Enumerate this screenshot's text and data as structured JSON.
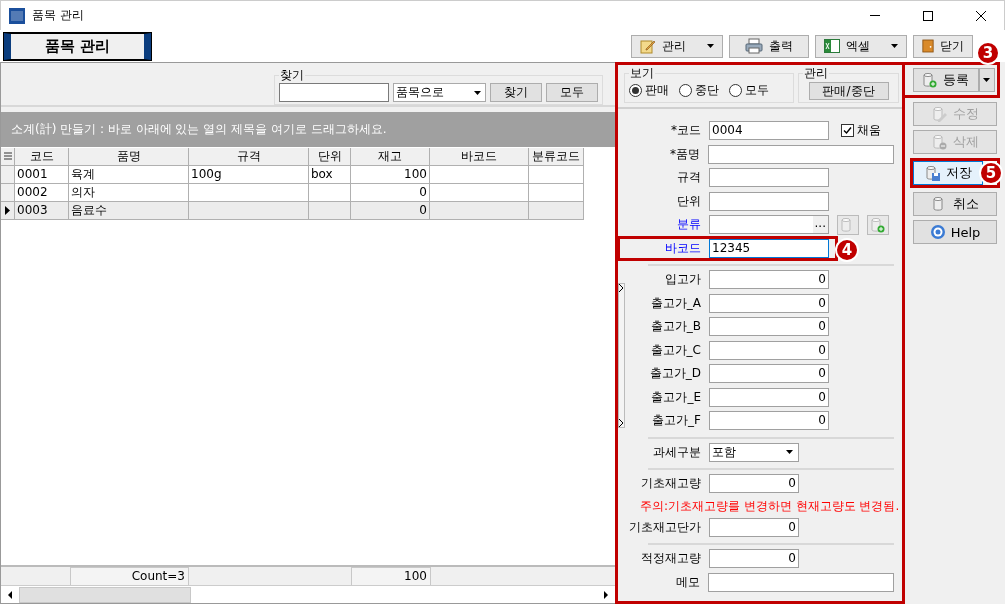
{
  "window": {
    "title": "품목 관리"
  },
  "header": {
    "title": "품목 관리"
  },
  "toolbar": [
    {
      "label": "관리",
      "kind": "menu"
    },
    {
      "label": "출력",
      "kind": "print"
    },
    {
      "label": "엑셀",
      "kind": "excel"
    },
    {
      "label": "닫기",
      "kind": "close"
    }
  ],
  "search": {
    "legend": "찾기",
    "mode": "품목으로",
    "buttons": [
      "찾기",
      "모두"
    ]
  },
  "group_hint": "소계(計) 만들기 : 바로 아래에 있는 열의 제목을 여기로 드래그하세요.",
  "table": {
    "columns": [
      "코드",
      "품명",
      "규격",
      "단위",
      "재고",
      "바코드",
      "분류코드"
    ],
    "rows": [
      {
        "cells": [
          "0001",
          "육계",
          "100g",
          "box",
          "100",
          "",
          ""
        ],
        "selected": false
      },
      {
        "cells": [
          "0002",
          "의자",
          "",
          "",
          "0",
          "",
          ""
        ],
        "selected": false
      },
      {
        "cells": [
          "0003",
          "음료수",
          "",
          "",
          "0",
          "",
          ""
        ],
        "selected": true
      }
    ]
  },
  "footer": {
    "count": "Count=3",
    "total": "100"
  },
  "view": {
    "legend": "보기",
    "options": [
      {
        "label": "판매",
        "selected": true
      },
      {
        "label": "중단",
        "selected": false
      },
      {
        "label": "모두",
        "selected": false
      }
    ]
  },
  "manage": {
    "legend": "관리",
    "button": "판매/중단"
  },
  "sections": [
    [
      {
        "kind": "text",
        "label": "*코드",
        "value": "0004",
        "checkbox": {
          "label": "채움",
          "checked": true
        }
      },
      {
        "kind": "wide",
        "label": "*품명"
      },
      {
        "kind": "text",
        "label": "규격"
      },
      {
        "kind": "text",
        "label": "단위"
      },
      {
        "kind": "lookup",
        "label": "분류",
        "link": true,
        "ellipsis": "..."
      },
      {
        "kind": "text",
        "label": "바코드",
        "value": "12345",
        "link": true,
        "focused": true,
        "callout": "4"
      }
    ],
    [
      {
        "kind": "number",
        "label": "입고가",
        "value": "0"
      },
      {
        "kind": "number",
        "label": "출고가_A",
        "value": "0"
      },
      {
        "kind": "number",
        "label": "출고가_B",
        "value": "0"
      },
      {
        "kind": "number",
        "label": "출고가_C",
        "value": "0"
      },
      {
        "kind": "number",
        "label": "출고가_D",
        "value": "0"
      },
      {
        "kind": "number",
        "label": "출고가_E",
        "value": "0"
      },
      {
        "kind": "number",
        "label": "출고가_F",
        "value": "0"
      }
    ],
    [
      {
        "kind": "select",
        "label": "과세구분",
        "value": "포함"
      }
    ],
    [
      {
        "kind": "small",
        "label": "기초재고량",
        "value": "0"
      },
      {
        "kind": "note",
        "text": "주의:기초재고량를 변경하면 현재고량도 변경됨."
      },
      {
        "kind": "small",
        "label": "기초재고단가",
        "value": "0"
      }
    ],
    [
      {
        "kind": "small",
        "label": "적정재고량",
        "value": "0"
      },
      {
        "kind": "wide",
        "label": "메모"
      }
    ]
  ],
  "actions": [
    {
      "label": "등록",
      "disabled": false,
      "selected": false,
      "dropdown": true,
      "callout": "3"
    },
    {
      "label": "수정",
      "disabled": true,
      "selected": false
    },
    {
      "label": "삭제",
      "disabled": true,
      "selected": false
    },
    {
      "label": "저장",
      "disabled": false,
      "selected": true,
      "callout": "5"
    },
    {
      "label": "취소",
      "disabled": false,
      "selected": false
    },
    {
      "label": "Help",
      "disabled": false,
      "selected": false
    }
  ]
}
